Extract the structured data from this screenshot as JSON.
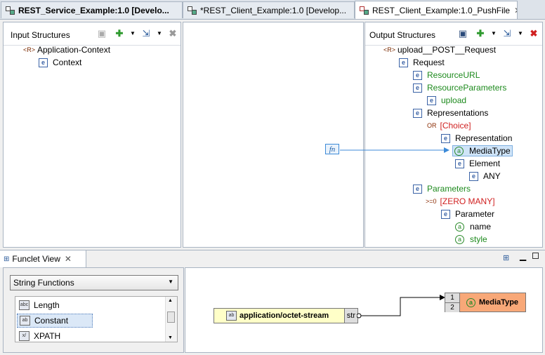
{
  "tabs": [
    {
      "label": "REST_Service_Example:1.0 [Develo..."
    },
    {
      "label": "*REST_Client_Example:1.0 [Develop..."
    },
    {
      "label": "REST_Client_Example:1.0_PushFile"
    }
  ],
  "input_structures": {
    "title": "Input Structures",
    "tree": [
      {
        "label": "Application-Context",
        "icon": "R"
      },
      {
        "label": "Context",
        "icon": "e"
      }
    ]
  },
  "output_structures": {
    "title": "Output Structures",
    "tree": [
      {
        "label": "upload__POST__Request",
        "icon": "R"
      },
      {
        "label": "Request",
        "icon": "e"
      },
      {
        "label": "ResourceURL",
        "icon": "e"
      },
      {
        "label": "ResourceParameters",
        "icon": "e"
      },
      {
        "label": "upload",
        "icon": "e"
      },
      {
        "label": "Representations",
        "icon": "e"
      },
      {
        "label": "[Choice]",
        "prefix": "OR"
      },
      {
        "label": "Representation",
        "icon": "e"
      },
      {
        "label": "MediaType",
        "icon": "a"
      },
      {
        "label": "Element",
        "icon": "e"
      },
      {
        "label": "ANY",
        "icon": "e"
      },
      {
        "label": "Parameters",
        "icon": "e"
      },
      {
        "label": "[ZERO MANY]",
        "prefix": ">=0"
      },
      {
        "label": "Parameter",
        "icon": "e"
      },
      {
        "label": "name",
        "icon": "a"
      },
      {
        "label": "style",
        "icon": "a"
      }
    ]
  },
  "mapping": {
    "function_label": "fn"
  },
  "funclet": {
    "title": "Funclet View",
    "category_selected": "String Functions",
    "functions": [
      {
        "label": "Length"
      },
      {
        "label": "Constant"
      },
      {
        "label": "XPATH"
      }
    ],
    "constant_value": "application/octet-stream",
    "constant_port": "str",
    "target": {
      "port1": "1",
      "port2": "2",
      "label": "MediaType"
    }
  },
  "colors": {
    "tree_green": "#1d8a1d",
    "tree_red": "#d02020",
    "constant_fill": "#ffffc8",
    "target_fill": "#f8a878",
    "link_blue": "#3c8ad8"
  }
}
